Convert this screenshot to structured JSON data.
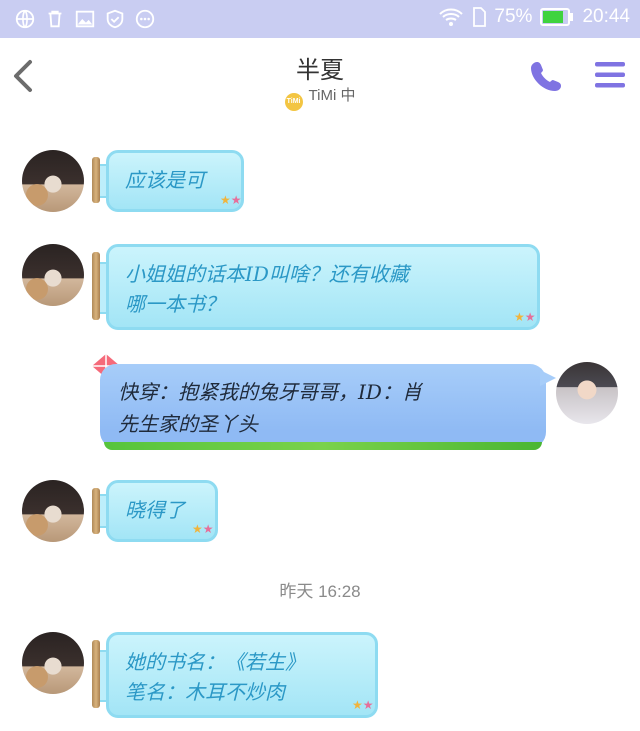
{
  "status_bar": {
    "battery": "75%",
    "time": "20:44"
  },
  "header": {
    "title": "半夏",
    "subtitle": "TiMi 中",
    "badge": "TiMi"
  },
  "messages": [
    {
      "text": "应该是可"
    },
    {
      "line1": "小姐姐的话本ID叫啥？还有收藏",
      "line2": "哪一本书？"
    },
    {
      "line1": "快穿：抱紧我的兔牙哥哥，ID：肖",
      "line2": "先生家的圣丫头"
    },
    {
      "text": "晓得了"
    },
    {
      "line1": "她的书名：《若生》",
      "line2": "笔名：木耳不炒肉"
    }
  ],
  "timestamp": "昨天 16:28",
  "colors": {
    "accent": "#7f73e2",
    "status_bar": "#c9cdf2",
    "bubble_text": "#2b98c6"
  }
}
